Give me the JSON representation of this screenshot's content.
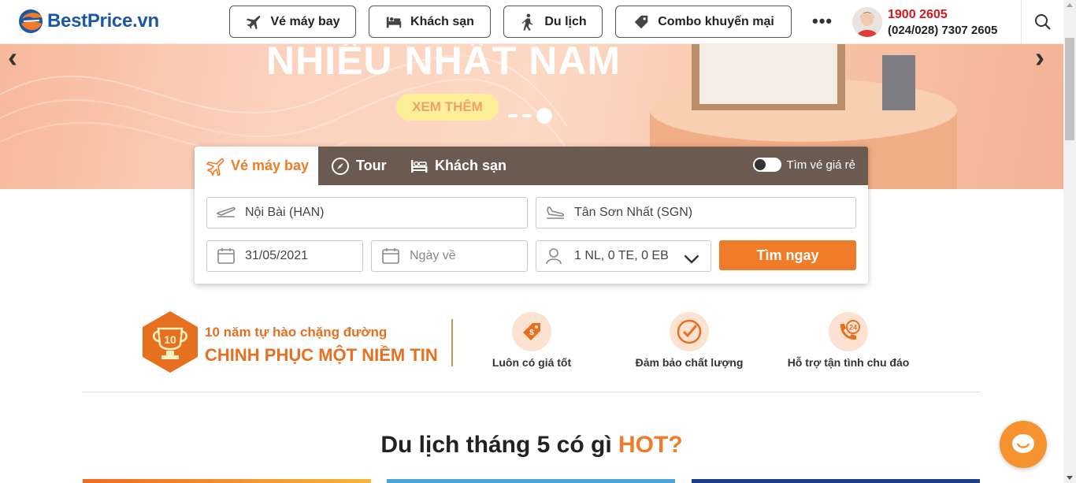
{
  "logo": {
    "text": "BestPrice",
    "suffix": ".vn"
  },
  "nav": [
    {
      "label": "Vé máy bay",
      "icon": "plane-icon"
    },
    {
      "label": "Khách sạn",
      "icon": "bed-icon"
    },
    {
      "label": "Du lịch",
      "icon": "walker-icon"
    },
    {
      "label": "Combo khuyến mại",
      "icon": "tag-icon"
    }
  ],
  "more_label": "•••",
  "hotline": {
    "primary": "1900 2605",
    "secondary": "(024/028) 7307 2605"
  },
  "banner": {
    "headline": "NHIỀU NHẤT NĂM",
    "cta": "XEM THÊM"
  },
  "search": {
    "tabs": [
      {
        "label": "Vé máy bay",
        "icon": "plane-icon"
      },
      {
        "label": "Tour",
        "icon": "compass-icon"
      },
      {
        "label": "Khách sạn",
        "icon": "bed-icon"
      }
    ],
    "cheap_toggle_label": "Tìm vé giá rẻ",
    "from": "Nội Bài (HAN)",
    "to": "Tân Sơn Nhất (SGN)",
    "depart_date": "31/05/2021",
    "return_placeholder": "Ngày về",
    "passengers": "1 NL, 0 TE, 0 EB",
    "submit": "Tìm ngay"
  },
  "pride": {
    "badge": "10",
    "line1": "10 năm tự hào chặng đường",
    "line2": "CHINH PHỤC MỘT NIỀM TIN"
  },
  "features": [
    {
      "label": "Luôn có giá tốt",
      "icon": "price-tag-icon"
    },
    {
      "label": "Đảm bảo chất lượng",
      "icon": "check-circle-icon"
    },
    {
      "label": "Hỗ trợ tận tình chu đáo",
      "icon": "support-24-icon"
    }
  ],
  "section": {
    "title_prefix": "Du lịch tháng 5 có gì ",
    "title_highlight": "HOT?"
  },
  "colors": {
    "brand_blue": "#1c57a5",
    "accent_orange": "#f07b28",
    "hotline_red": "#d6161e",
    "tab_bar": "#6b5a50"
  }
}
